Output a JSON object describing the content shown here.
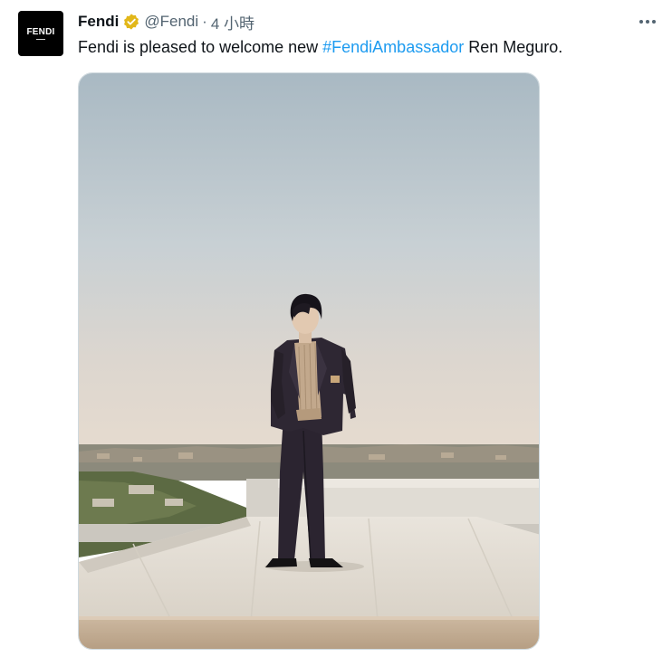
{
  "tweet": {
    "avatar_text": "FENDI",
    "display_name": "Fendi",
    "verified_icon": "verified-badge-icon",
    "handle": "@Fendi",
    "separator": "·",
    "time": "4 小時",
    "text_before": "Fendi is pleased to welcome new ",
    "hashtag": "#FendiAmbassador",
    "text_after": " Ren Meguro.",
    "more_icon": "more-options-icon"
  },
  "colors": {
    "link": "#1d9bf0",
    "secondary_text": "#536471",
    "verified_gold": "#e2b719",
    "border": "#cfd9de"
  }
}
